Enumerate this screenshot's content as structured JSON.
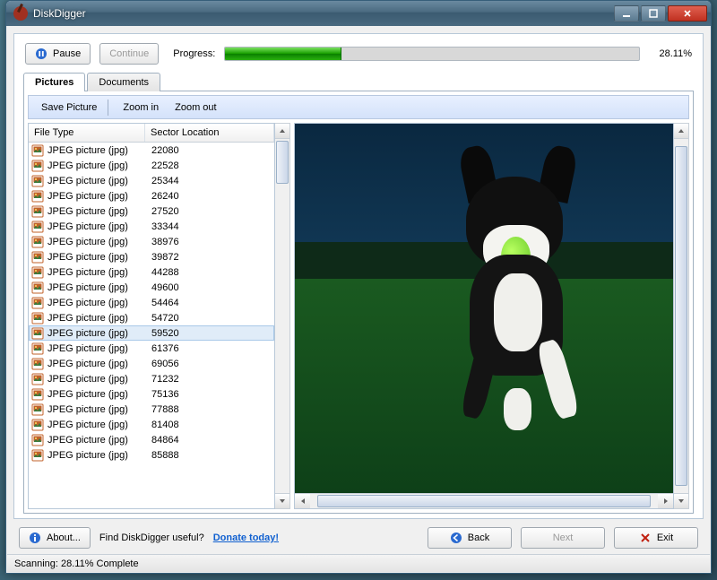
{
  "window": {
    "title": "DiskDigger"
  },
  "controls": {
    "pause": "Pause",
    "continue": "Continue",
    "progress_label": "Progress:",
    "progress_pct": 28.11,
    "progress_text": "28.11%"
  },
  "tabs": {
    "pictures": "Pictures",
    "documents": "Documents",
    "active": "pictures"
  },
  "toolbar": {
    "save": "Save Picture",
    "zoom_in": "Zoom in",
    "zoom_out": "Zoom out"
  },
  "columns": {
    "filetype": "File Type",
    "sector": "Sector Location"
  },
  "rows": [
    {
      "type": "JPEG picture (jpg)",
      "sector": "22080"
    },
    {
      "type": "JPEG picture (jpg)",
      "sector": "22528"
    },
    {
      "type": "JPEG picture (jpg)",
      "sector": "25344"
    },
    {
      "type": "JPEG picture (jpg)",
      "sector": "26240"
    },
    {
      "type": "JPEG picture (jpg)",
      "sector": "27520"
    },
    {
      "type": "JPEG picture (jpg)",
      "sector": "33344"
    },
    {
      "type": "JPEG picture (jpg)",
      "sector": "38976"
    },
    {
      "type": "JPEG picture (jpg)",
      "sector": "39872"
    },
    {
      "type": "JPEG picture (jpg)",
      "sector": "44288"
    },
    {
      "type": "JPEG picture (jpg)",
      "sector": "49600"
    },
    {
      "type": "JPEG picture (jpg)",
      "sector": "54464"
    },
    {
      "type": "JPEG picture (jpg)",
      "sector": "54720"
    },
    {
      "type": "JPEG picture (jpg)",
      "sector": "59520",
      "selected": true
    },
    {
      "type": "JPEG picture (jpg)",
      "sector": "61376"
    },
    {
      "type": "JPEG picture (jpg)",
      "sector": "69056"
    },
    {
      "type": "JPEG picture (jpg)",
      "sector": "71232"
    },
    {
      "type": "JPEG picture (jpg)",
      "sector": "75136"
    },
    {
      "type": "JPEG picture (jpg)",
      "sector": "77888"
    },
    {
      "type": "JPEG picture (jpg)",
      "sector": "81408"
    },
    {
      "type": "JPEG picture (jpg)",
      "sector": "84864"
    },
    {
      "type": "JPEG picture (jpg)",
      "sector": "85888"
    }
  ],
  "bottom": {
    "about": "About...",
    "useful_text": "Find DiskDigger useful?",
    "donate": "Donate today!",
    "back": "Back",
    "next": "Next",
    "exit": "Exit"
  },
  "status": "Scanning: 28.11% Complete",
  "preview_desc": "Photo preview: black-and-white dog running on grass holding a green ball"
}
